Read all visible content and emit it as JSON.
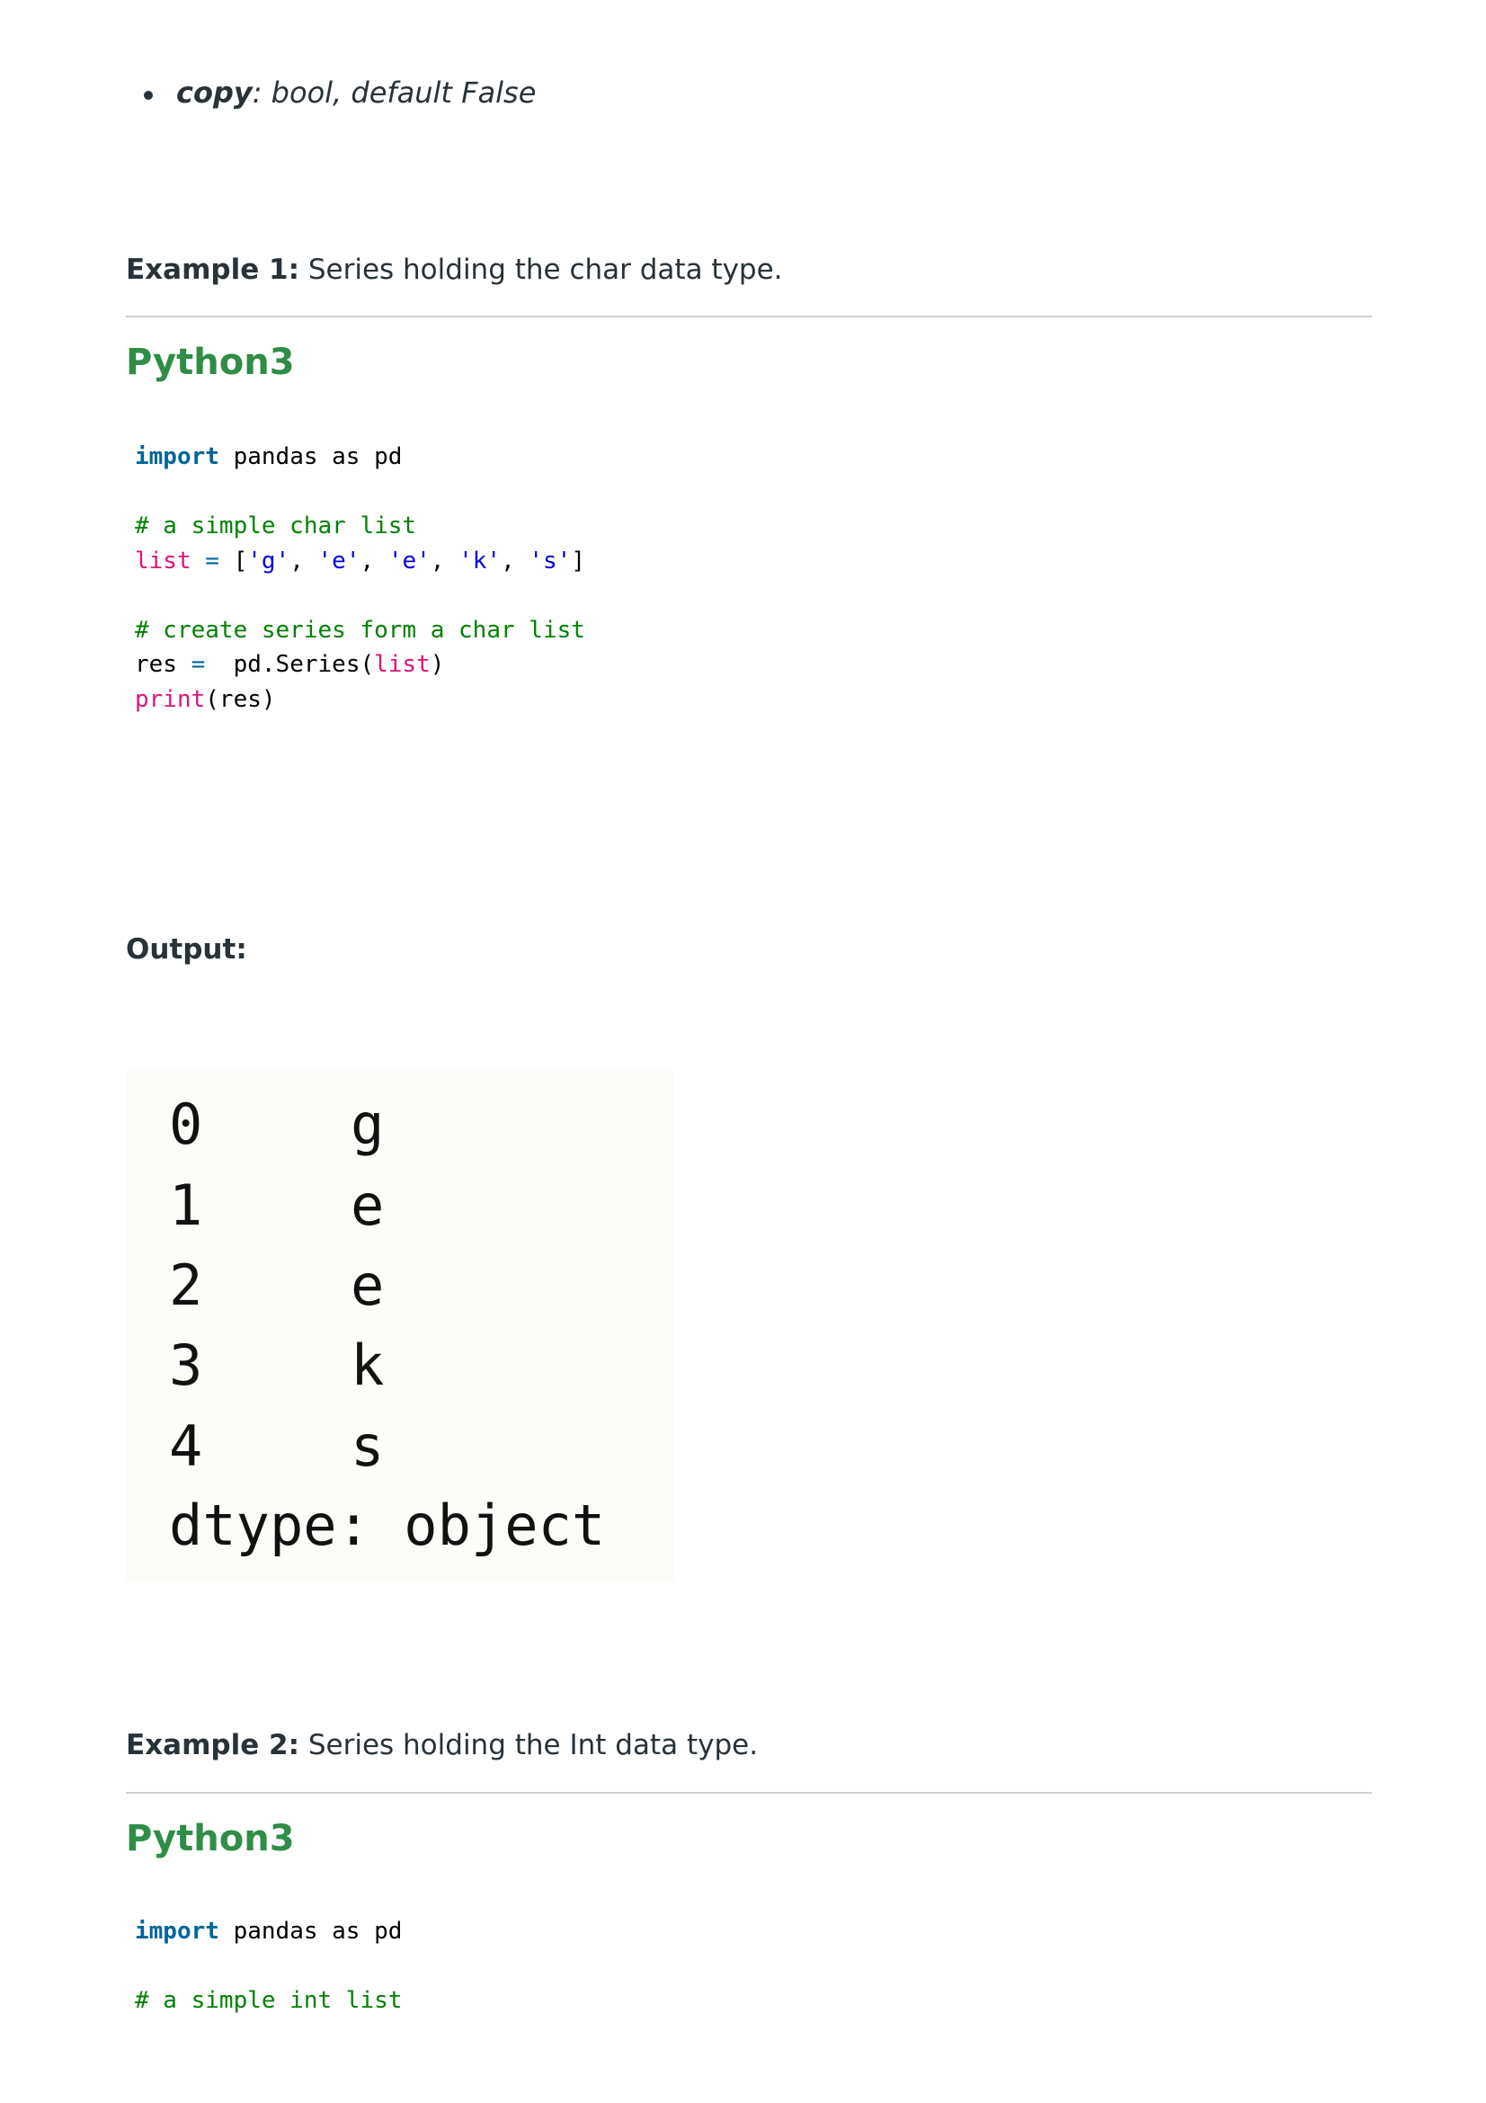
{
  "param": {
    "name": "copy",
    "desc": ": bool, default False"
  },
  "example1": {
    "label": "Example 1:",
    "text": " Series holding the char data type."
  },
  "example2": {
    "label": "Example 2:",
    "text": " Series holding the Int data type."
  },
  "lang_label": "Python3",
  "code1": {
    "import_kw": "import",
    "import_rest": " pandas as pd",
    "comment1": "# a simple char list",
    "list_kw": "list",
    "eq": " = ",
    "open": "[",
    "chars": [
      "'g'",
      "'e'",
      "'e'",
      "'k'",
      "'s'"
    ],
    "sep": ", ",
    "close": "]",
    "comment2": "# create series form a char list",
    "res": "res",
    "series_call": " pd.Series(",
    "list_arg": "list",
    "paren_close": ")",
    "print_kw": "print",
    "print_arg": "(res)"
  },
  "output_label": "Output:",
  "output": {
    "index": [
      "0",
      "1",
      "2",
      "3",
      "4"
    ],
    "values": [
      "g",
      "e",
      "e",
      "k",
      "s"
    ],
    "dtype": "dtype: object"
  },
  "code2": {
    "import_kw": "import",
    "import_rest": " pandas as pd",
    "comment1": "# a simple int list"
  }
}
